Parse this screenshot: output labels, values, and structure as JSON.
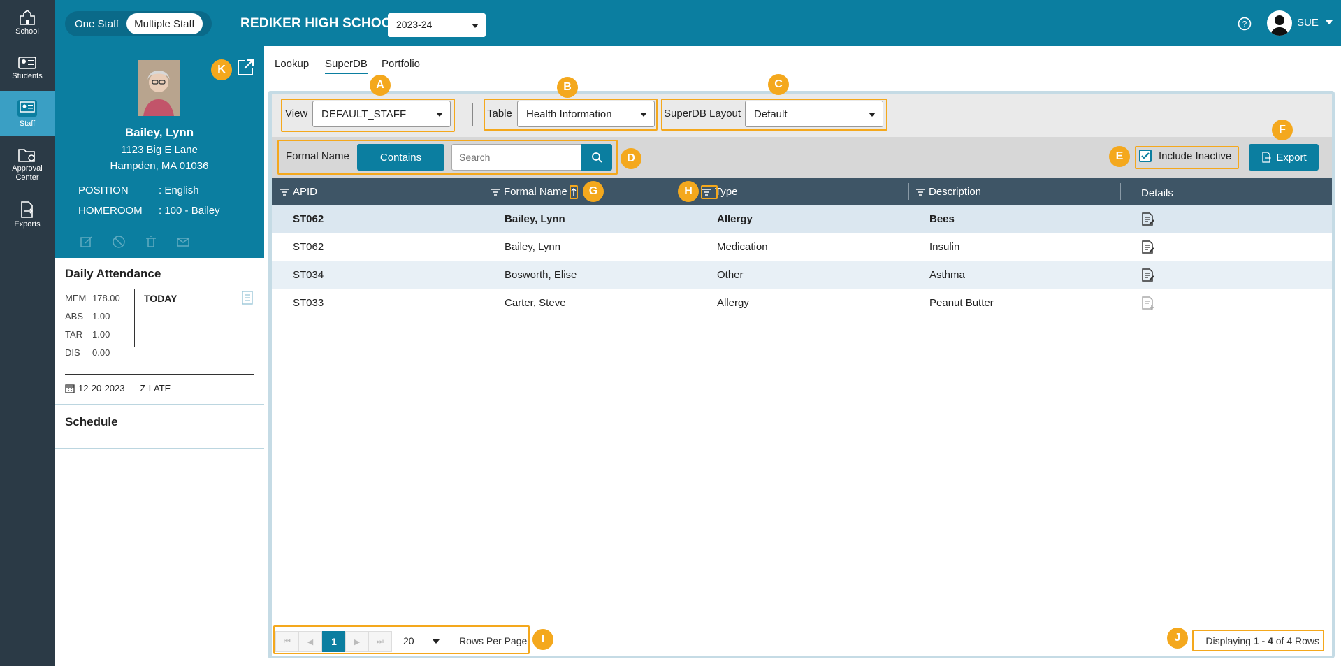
{
  "nav": [
    {
      "label": "School",
      "icon": "school-icon"
    },
    {
      "label": "Students",
      "icon": "students-icon"
    },
    {
      "label": "Staff",
      "icon": "staff-icon"
    },
    {
      "label": "Approval Center",
      "icon": "approval-center-icon"
    },
    {
      "label": "Exports",
      "icon": "exports-icon"
    }
  ],
  "topbar": {
    "toggle_one": "One Staff",
    "toggle_multiple": "Multiple Staff",
    "school": "REDIKER HIGH SCHOOL",
    "year": "2023-24",
    "user": "SUE"
  },
  "profile": {
    "name": "Bailey, Lynn",
    "address1": "1123 Big E Lane",
    "address2": "Hampden, MA 01036",
    "position_label": "POSITION",
    "position_value": ": English",
    "homeroom_label": "HOMEROOM",
    "homeroom_value": ": 100 - Bailey"
  },
  "attendance": {
    "title": "Daily Attendance",
    "stats": [
      {
        "k": "MEM",
        "v": "178.00"
      },
      {
        "k": "ABS",
        "v": "1.00"
      },
      {
        "k": "TAR",
        "v": "1.00"
      },
      {
        "k": "DIS",
        "v": "0.00"
      }
    ],
    "today": "TODAY",
    "date": "12-20-2023",
    "code": "Z-LATE"
  },
  "schedule": {
    "title": "Schedule"
  },
  "tabs": [
    "Lookup",
    "SuperDB",
    "Portfolio"
  ],
  "filters": {
    "view_label": "View",
    "view_value": "DEFAULT_STAFF",
    "table_label": "Table",
    "table_value": "Health Information",
    "layout_label": "SuperDB Layout",
    "layout_value": "Default",
    "search_field_label": "Formal Name",
    "operator": "Contains",
    "search_placeholder": "Search",
    "include_inactive": "Include Inactive",
    "include_inactive_checked": true,
    "export": "Export"
  },
  "table": {
    "columns": [
      "APID",
      "Formal Name",
      "Type",
      "Description",
      "Details"
    ],
    "rows": [
      {
        "apid": "ST062",
        "name": "Bailey, Lynn",
        "type": "Allergy",
        "desc": "Bees"
      },
      {
        "apid": "ST062",
        "name": "Bailey, Lynn",
        "type": "Medication",
        "desc": "Insulin"
      },
      {
        "apid": "ST034",
        "name": "Bosworth, Elise",
        "type": "Other",
        "desc": "Asthma"
      },
      {
        "apid": "ST033",
        "name": "Carter, Steve",
        "type": "Allergy",
        "desc": "Peanut Butter"
      }
    ]
  },
  "pager": {
    "page": "1",
    "rows_per_page": "20",
    "rows_per_page_label": "Rows Per Page",
    "display_prefix": "Displaying",
    "display_range": "1 - 4",
    "display_suffix": "of 4 Rows"
  },
  "callouts": [
    "A",
    "B",
    "C",
    "D",
    "E",
    "F",
    "G",
    "H",
    "I",
    "J",
    "K"
  ],
  "colors": {
    "primary": "#0b7ea0",
    "nav": "#2b3a46",
    "callout": "#f4a81d",
    "table_header": "#3e5566"
  }
}
